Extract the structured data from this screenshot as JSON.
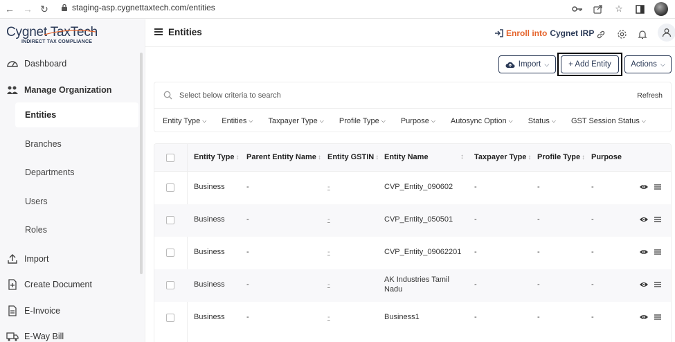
{
  "browser": {
    "url": "staging-asp.cygnettaxtech.com/entities"
  },
  "logo": {
    "main": "Cygnet TaxTech",
    "sub": "INDIRECT TAX COMPLIANCE"
  },
  "sidebar": {
    "items": [
      {
        "label": "Dashboard",
        "icon": "dashboard-icon"
      },
      {
        "label": "Manage Organization",
        "icon": "organization-icon"
      },
      {
        "label": "Import",
        "icon": "upload-icon"
      },
      {
        "label": "Create Document",
        "icon": "document-plus-icon"
      },
      {
        "label": "E-Invoice",
        "icon": "invoice-icon"
      },
      {
        "label": "E-Way Bill",
        "icon": "truck-icon"
      }
    ],
    "sub_items": [
      {
        "label": "Entities",
        "active": true
      },
      {
        "label": "Branches"
      },
      {
        "label": "Departments"
      },
      {
        "label": "Users"
      },
      {
        "label": "Roles"
      }
    ]
  },
  "header": {
    "title": "Entities",
    "enroll_a": "Enroll into",
    "enroll_b": "Cygnet IRP"
  },
  "toolbar": {
    "import_label": "Import",
    "add_label": "+ Add Entity",
    "actions_label": "Actions"
  },
  "search": {
    "placeholder": "Select below criteria to search",
    "refresh_label": "Refresh"
  },
  "filters": [
    "Entity Type",
    "Entities",
    "Taxpayer Type",
    "Profile Type",
    "Purpose",
    "Autosync Option",
    "Status",
    "GST Session Status"
  ],
  "table": {
    "columns": [
      "Entity Type",
      "Parent Entity Name",
      "Entity GSTIN",
      "Entity Name",
      "Taxpayer Type",
      "Profile Type",
      "Purpose"
    ],
    "rows": [
      {
        "type": "Business",
        "parent": "-",
        "gstin": "-",
        "name": "CVP_Entity_090602",
        "name2": "",
        "taxpayer": "-",
        "profile": "-",
        "purpose": "-"
      },
      {
        "type": "Business",
        "parent": "-",
        "gstin": "-",
        "name": "CVP_Entity_050501",
        "name2": "",
        "taxpayer": "-",
        "profile": "-",
        "purpose": "-"
      },
      {
        "type": "Business",
        "parent": "-",
        "gstin": "-",
        "name": "CVP_Entity_09062201",
        "name2": "",
        "taxpayer": "-",
        "profile": "-",
        "purpose": "-"
      },
      {
        "type": "Business",
        "parent": "-",
        "gstin": "-",
        "name": "AK Industries Tamil",
        "name2": "Nadu",
        "taxpayer": "-",
        "profile": "-",
        "purpose": "-"
      },
      {
        "type": "Business",
        "parent": "-",
        "gstin": "-",
        "name": "Business1",
        "name2": "",
        "taxpayer": "-",
        "profile": "-",
        "purpose": "-"
      }
    ]
  },
  "colors": {
    "navy": "#2b3a57",
    "orange": "#e5632a"
  }
}
